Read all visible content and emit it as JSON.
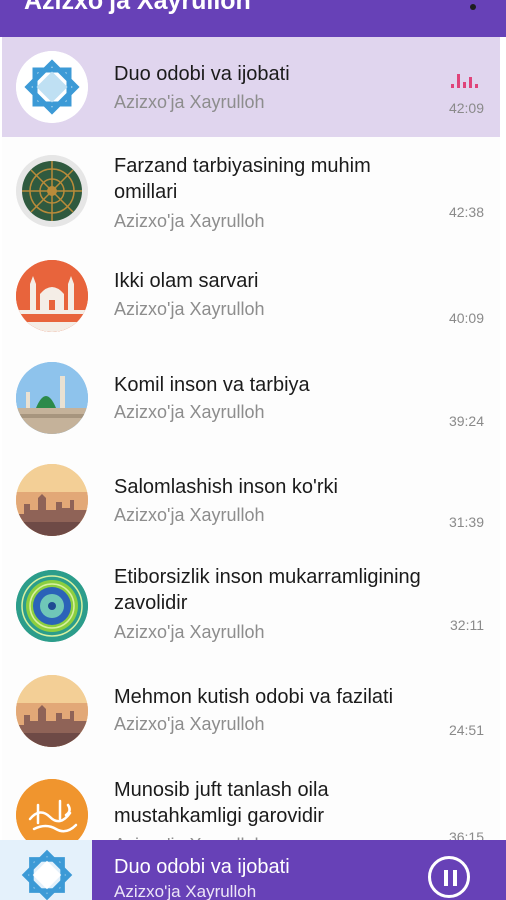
{
  "app": {
    "title": "Azizxo'ja Xayrulloh"
  },
  "tracks": [
    {
      "title": "Duo odobi va ijobati",
      "artist": "Azizxo'ja Xayrulloh",
      "duration": "42:09",
      "active": true,
      "art": "blue-star-icon"
    },
    {
      "title": "Farzand tarbiyasining muhim omillari",
      "artist": "Azizxo'ja Xayrulloh",
      "duration": "42:38",
      "art": "green-rosette-icon"
    },
    {
      "title": "Ikki olam sarvari",
      "artist": "Azizxo'ja Xayrulloh",
      "duration": "40:09",
      "art": "mosque-icon"
    },
    {
      "title": "Komil inson va tarbiya",
      "artist": "Azizxo'ja Xayrulloh",
      "duration": "39:24",
      "art": "green-dome-icon"
    },
    {
      "title": "Salomlashish inson ko'rki",
      "artist": "Azizxo'ja Xayrulloh",
      "duration": "31:39",
      "art": "sunset-skyline-icon"
    },
    {
      "title": "Etiborsizlik inson mukarramligining zavolidir",
      "artist": "Azizxo'ja Xayrulloh",
      "duration": "32:11",
      "art": "teal-mandala-icon"
    },
    {
      "title": "Mehmon kutish odobi va fazilati",
      "artist": "Azizxo'ja Xayrulloh",
      "duration": "24:51",
      "art": "sunset-skyline-icon"
    },
    {
      "title": "Munosib juft tanlash oila mustahkamligi garovidir",
      "artist": "Azizxo'ja Xayrulloh",
      "duration": "36:15",
      "art": "orange-calligraphy-icon"
    }
  ],
  "now_playing": {
    "title": "Duo odobi va ijobati",
    "artist": "Azizxo'ja Xayrulloh",
    "state_icon": "pause-icon"
  },
  "colors": {
    "accent": "#6741b7",
    "active_row": "#e0d5ee",
    "eq": "#e0447a"
  }
}
